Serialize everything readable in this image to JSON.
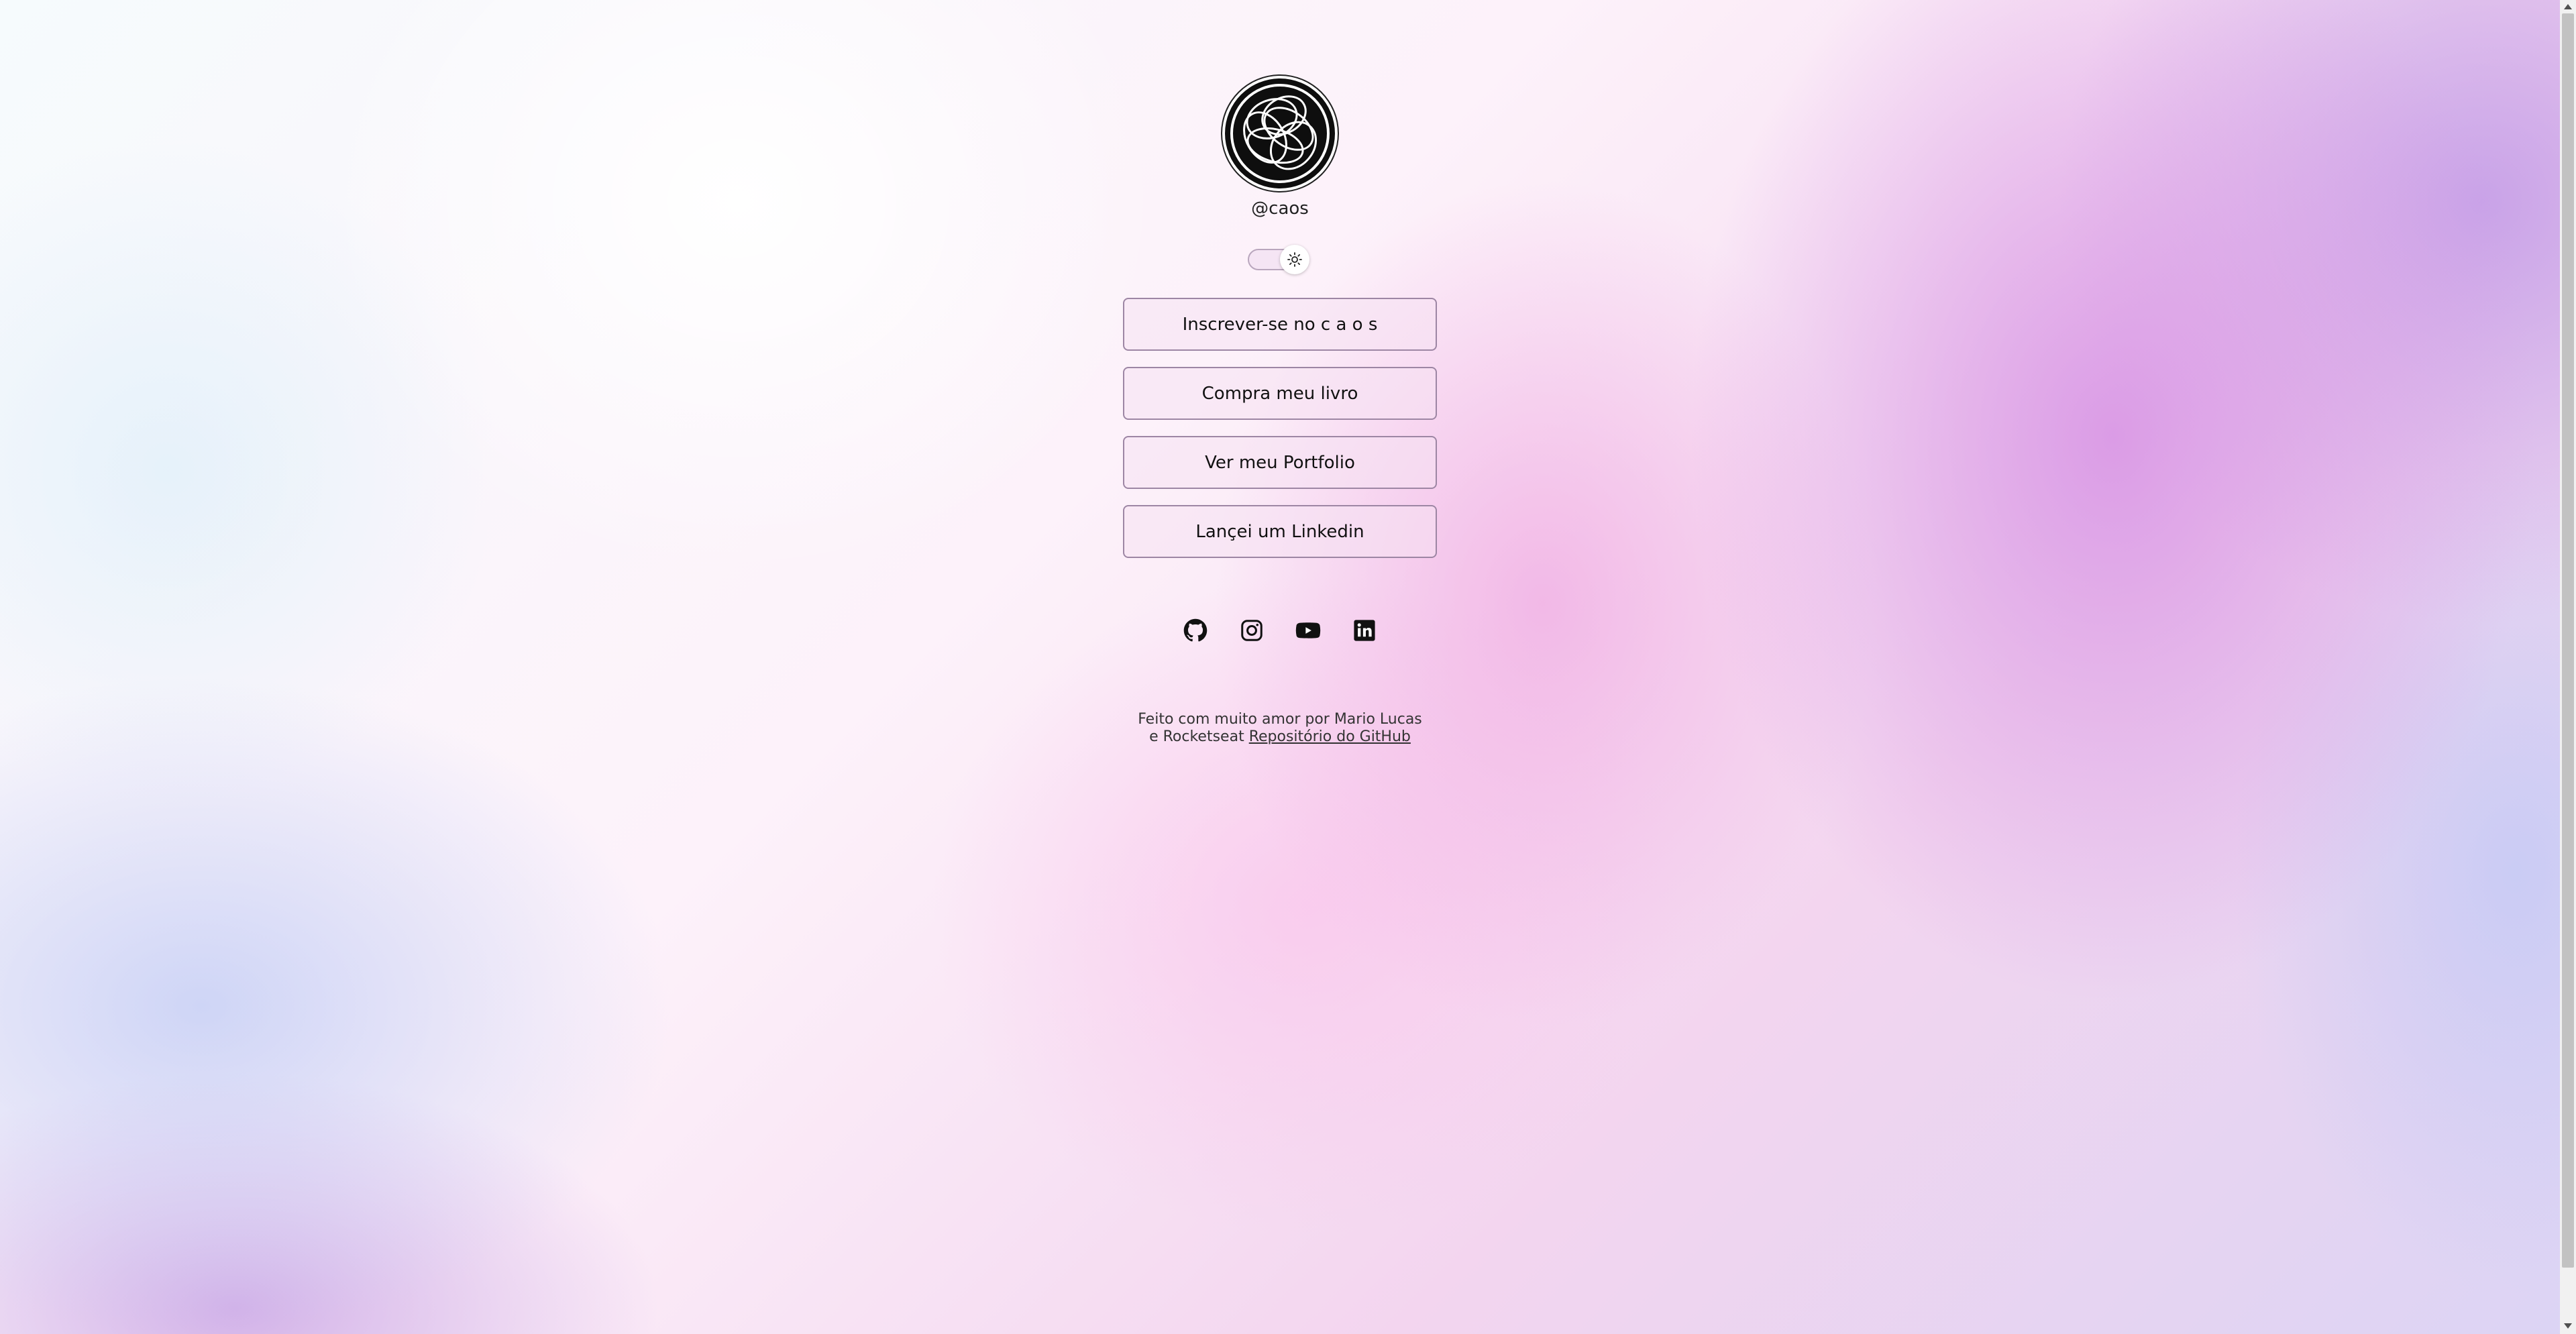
{
  "profile": {
    "username": "@caos"
  },
  "theme_toggle": {
    "icon": "sun-icon"
  },
  "links": [
    {
      "label": "Inscrever-se no c a o s"
    },
    {
      "label": "Compra meu livro"
    },
    {
      "label": "Ver meu Portfolio"
    },
    {
      "label": "Lançei um Linkedin"
    }
  ],
  "social": [
    {
      "icon": "github-icon"
    },
    {
      "icon": "instagram-icon"
    },
    {
      "icon": "youtube-icon"
    },
    {
      "icon": "linkedin-icon"
    }
  ],
  "footer": {
    "text": "Feito com muito amor por Mario Lucas e Rocketseat",
    "link_label": "Repositório do GitHub"
  }
}
